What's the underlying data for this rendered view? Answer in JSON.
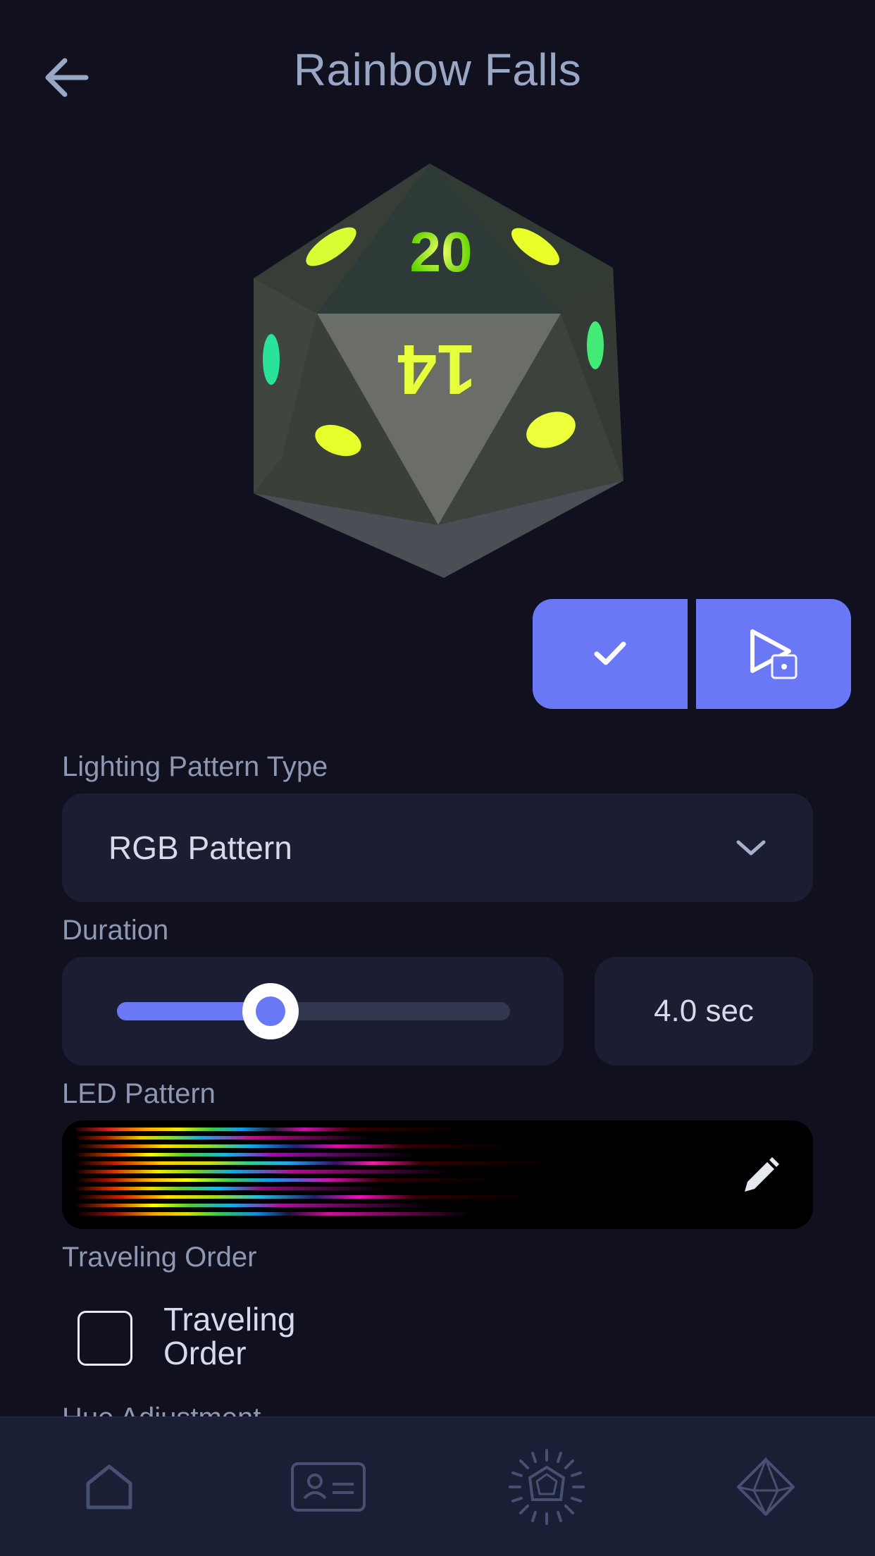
{
  "header": {
    "title": "Rainbow Falls",
    "back_icon": "arrow-left-icon"
  },
  "preview": {
    "die_faces": [
      "20",
      "14"
    ]
  },
  "actions": {
    "confirm_icon": "checkmark-icon",
    "preview_icon": "play-die-icon"
  },
  "lighting_pattern": {
    "label": "Lighting Pattern Type",
    "selected": "RGB Pattern"
  },
  "duration": {
    "label": "Duration",
    "value_text": "4.0 sec",
    "slider_fraction": 0.39
  },
  "led_pattern": {
    "label": "LED Pattern",
    "edit_icon": "pencil-icon"
  },
  "traveling_order": {
    "label": "Traveling Order",
    "checkbox_label": "Traveling Order",
    "checked": false
  },
  "hue_adjustment": {
    "label": "Hue Adjustment"
  },
  "nav": {
    "items": [
      {
        "name": "home",
        "icon": "home-icon"
      },
      {
        "name": "profile",
        "icon": "id-card-icon"
      },
      {
        "name": "lighting",
        "icon": "sun-die-icon"
      },
      {
        "name": "dice",
        "icon": "d20-icon"
      }
    ]
  },
  "colors": {
    "background": "#10101f",
    "accent": "#6b78f6",
    "card": "#1b1d33"
  }
}
